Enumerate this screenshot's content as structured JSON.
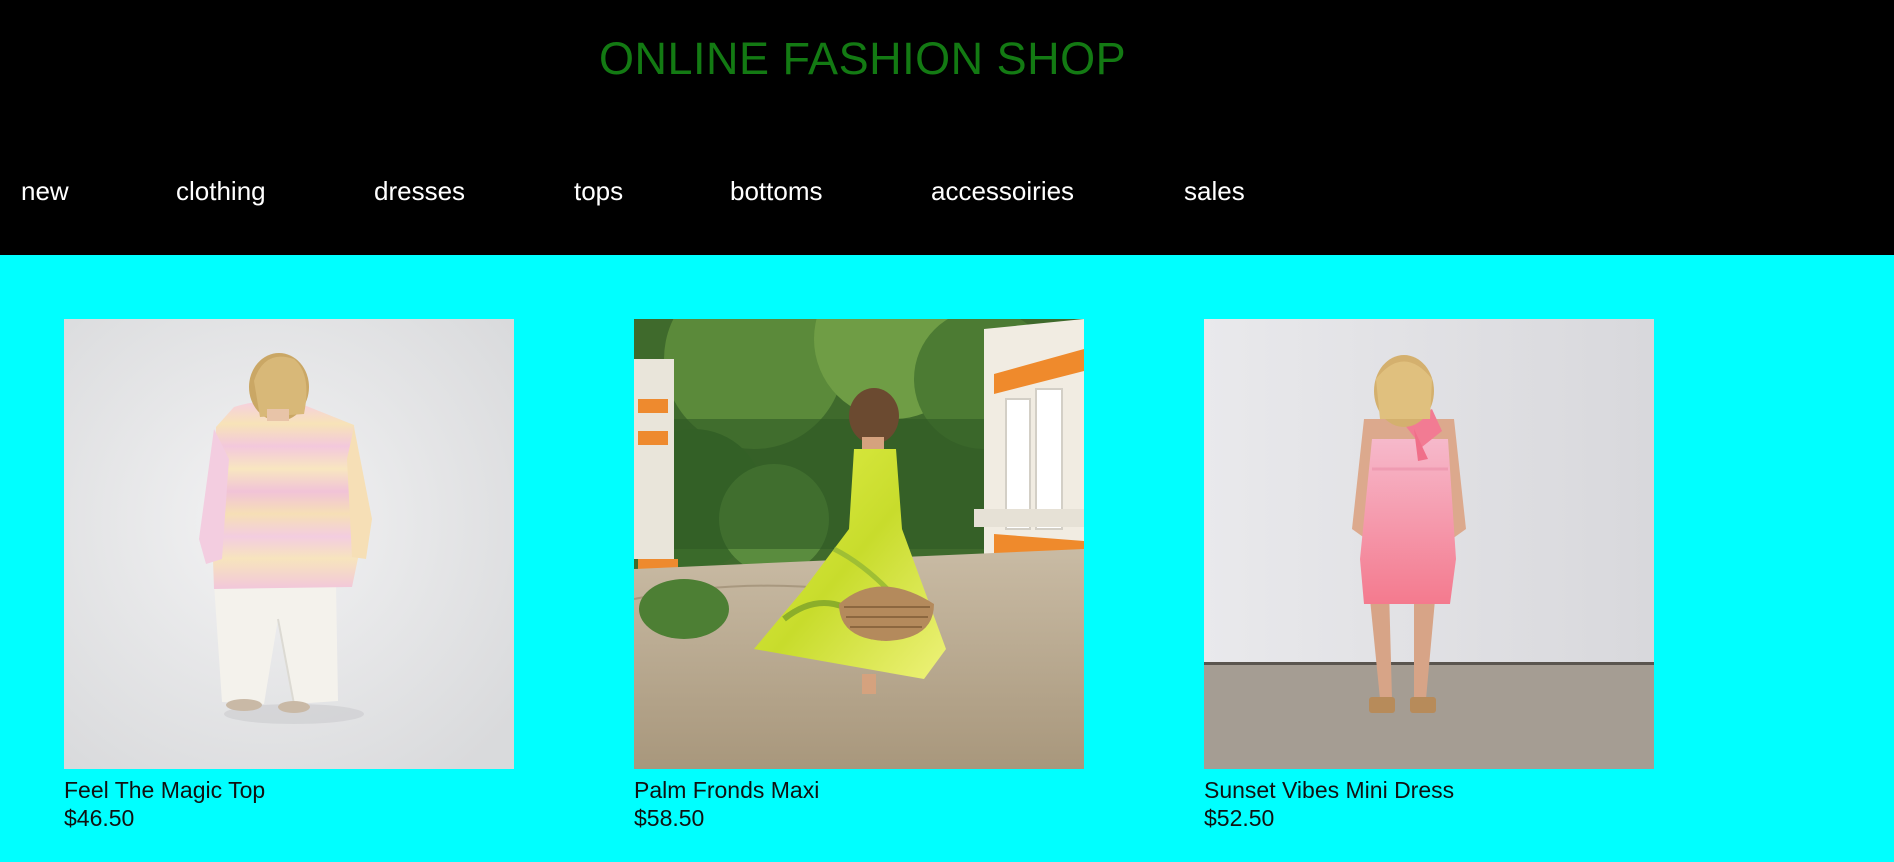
{
  "header": {
    "title": "ONLINE FASHION SHOP"
  },
  "nav": {
    "items": [
      {
        "label": "new"
      },
      {
        "label": "clothing"
      },
      {
        "label": "dresses"
      },
      {
        "label": "tops"
      },
      {
        "label": "bottoms"
      },
      {
        "label": "accessoiries"
      },
      {
        "label": "sales"
      }
    ]
  },
  "products": [
    {
      "name": "Feel The Magic Top",
      "price": "$46.50"
    },
    {
      "name": "Palm Fronds Maxi",
      "price": "$58.50"
    },
    {
      "name": "Sunset Vibes Mini Dress",
      "price": "$52.50"
    }
  ],
  "colors": {
    "header_bg": "#000000",
    "title_color": "#137a13",
    "nav_text": "#ffffff",
    "content_bg": "#00ffff",
    "product_text": "#111111"
  }
}
